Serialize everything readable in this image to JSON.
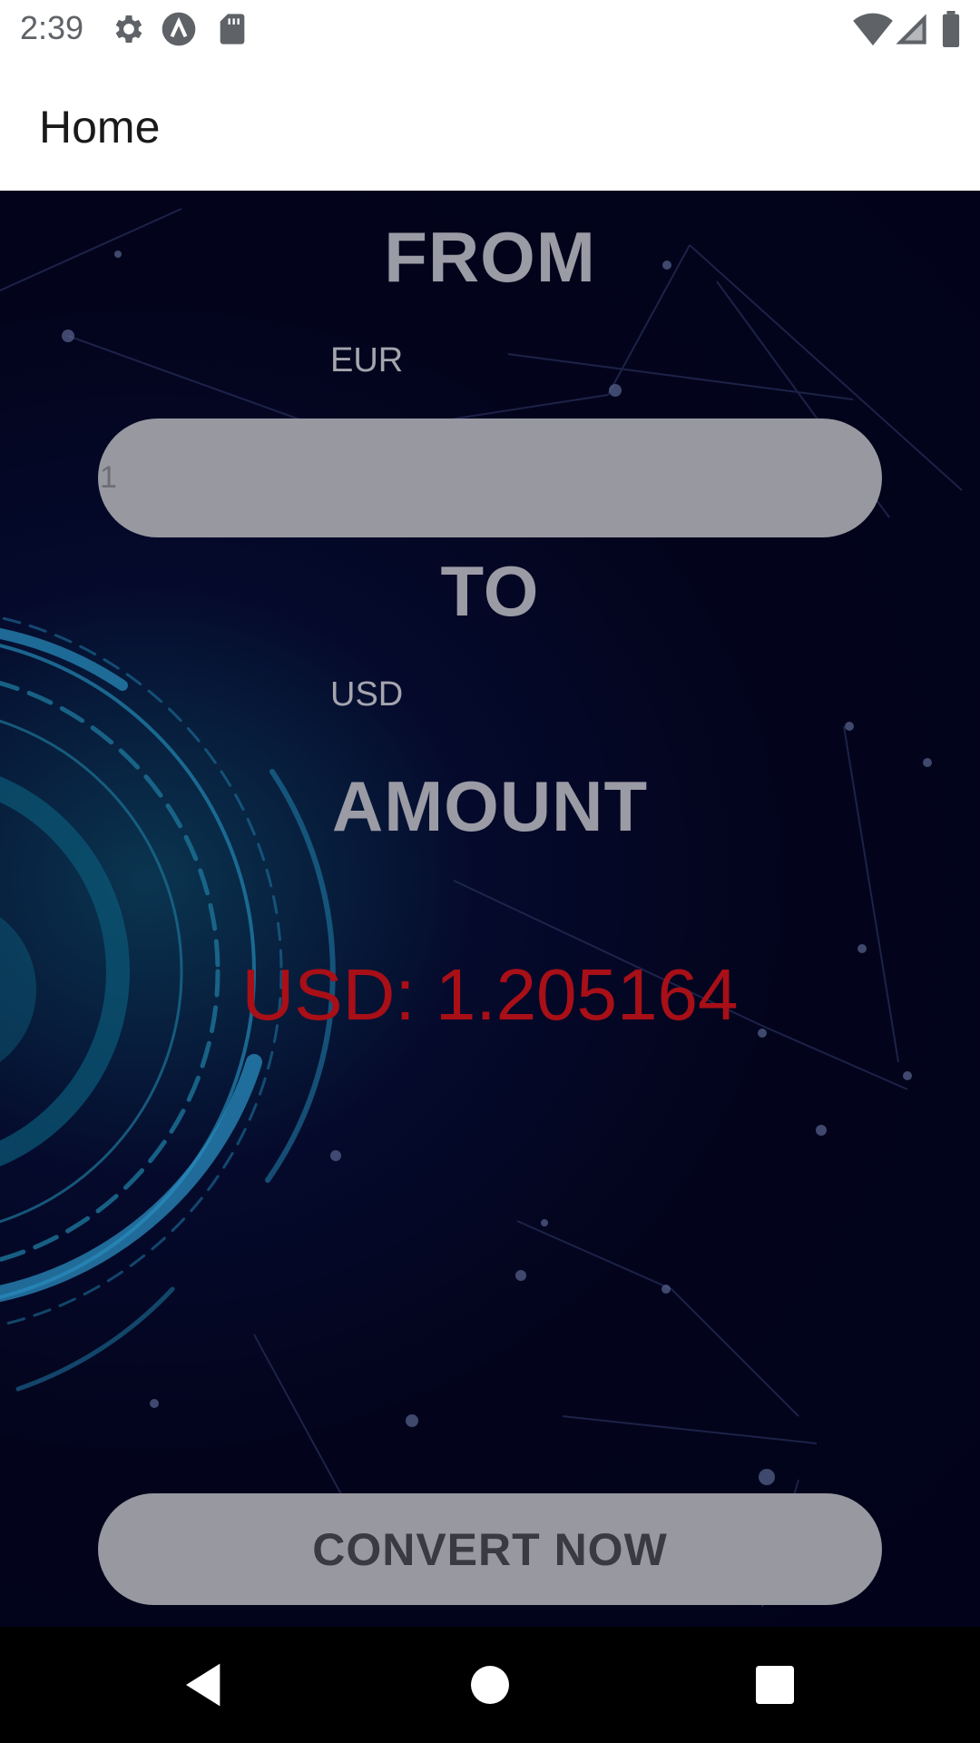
{
  "status_bar": {
    "time": "2:39",
    "left_icons": [
      "gear-icon",
      "app-a-icon",
      "sd-card-icon"
    ],
    "right_icons": [
      "wifi-icon",
      "cellular-signal-icon",
      "battery-icon"
    ]
  },
  "app_bar": {
    "title": "Home"
  },
  "converter": {
    "from_heading": "FROM",
    "from_currency": "EUR",
    "amount_value": "1",
    "to_heading": "TO",
    "to_currency": "USD",
    "amount_heading": "AMOUNT",
    "result": "USD: 1.205164",
    "convert_button_label": "CONVERT NOW"
  },
  "nav_bar": {
    "buttons": [
      "back-icon",
      "home-icon",
      "recents-icon"
    ]
  },
  "colors": {
    "result_text": "#a80f17",
    "input_background": "#9898a1",
    "heading_text": "#9b9ba5",
    "content_background": "#02031a"
  }
}
